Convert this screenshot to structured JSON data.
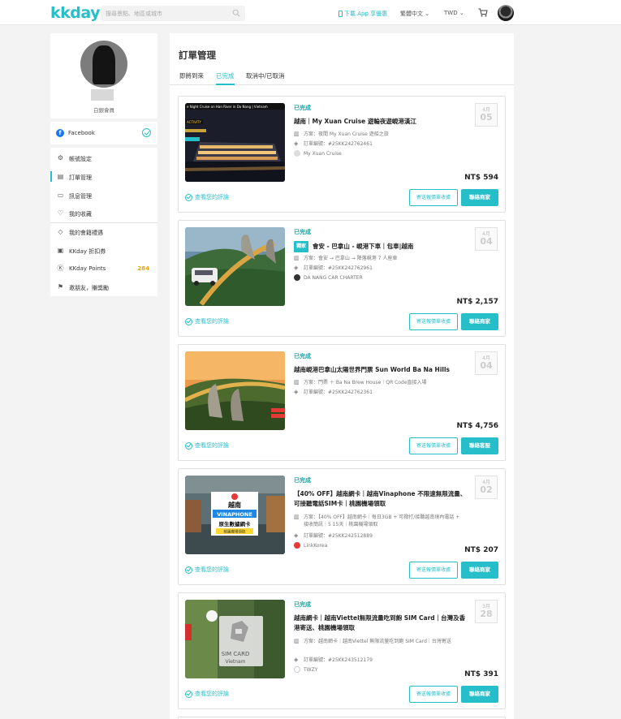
{
  "header": {
    "logo": "kkday",
    "search_placeholder": "搜尋景點、地區或城市",
    "app_link": "下載 App 享優惠",
    "language": "繁體中文 ⌄",
    "currency": "TWD ⌄"
  },
  "sidebar": {
    "member_label": "白銀會員",
    "facebook_label": "Facebook",
    "menu": [
      {
        "label": "帳號設定",
        "icon": "gear-icon"
      },
      {
        "label": "訂單管理",
        "icon": "order-icon"
      },
      {
        "label": "訊息管理",
        "icon": "message-icon"
      },
      {
        "label": "我的收藏",
        "icon": "heart-icon"
      },
      {
        "label": "我的會籍禮遇",
        "icon": "diamond-icon"
      },
      {
        "label": "KKday 折扣券",
        "icon": "coupon-icon"
      },
      {
        "label": "KKday Points",
        "icon": "points-icon",
        "count": "284"
      },
      {
        "label": "邀朋友，賺獎勵",
        "icon": "flag-icon"
      }
    ]
  },
  "main": {
    "title": "訂單管理",
    "tabs": [
      "即將到來",
      "已完成",
      "取消中/已取消"
    ],
    "active_tab": "已完成"
  },
  "orders": [
    {
      "status": "已完成",
      "title": "越南｜My Xuan Cruise 遊輪夜遊峴港漢江",
      "tag": "",
      "plan": "方案：夜間 My Xuan Cruise 遊船之旅",
      "order_no": "訂單編號：#25KK242762461",
      "supplier": "My Xuan Cruise",
      "month": "4月",
      "day": "05",
      "price": "NT$ 594",
      "review": "查看您的評論",
      "btn_outline": "寄送報價單收據",
      "btn_fill": "聯絡商家"
    },
    {
      "status": "已完成",
      "title": "會安 - 巴拿山 - 峴港下車｜包車|越南",
      "tag": "獨家",
      "plan": "方案：會安 → 巴拿山 → 降落峴港 7 人座車",
      "order_no": "訂單編號：#25KK242762961",
      "supplier": "DA NANG CAR CHARTER",
      "month": "4月",
      "day": "04",
      "price": "NT$ 2,157",
      "review": "查看您的評論",
      "btn_outline": "寄送報價單收據",
      "btn_fill": "聯絡商家"
    },
    {
      "status": "已完成",
      "title": "越南峴港巴拿山太陽世界門票 Sun World Ba Na Hills",
      "tag": "",
      "plan": "方案：門票 ＋ Ba Na Brew House｜QR Code直接入場",
      "order_no": "訂單編號：#25KK242762361",
      "supplier": "",
      "month": "4月",
      "day": "04",
      "price": "NT$ 4,756",
      "review": "查看您的評論",
      "btn_outline": "寄送報價單收據",
      "btn_fill": "聯絡客服"
    },
    {
      "status": "已完成",
      "title": "【40% OFF】越南網卡｜越南Vinaphone 不限速無限流量、可接聽電話SIM卡｜桃園機場領取",
      "tag": "",
      "plan": "方案：【40% OFF】越南網卡｜每日3GB + 可撥打/接聽越南境內電話 + 接收簡訊｜5 15天｜桃園機場領取",
      "order_no": "訂單編號：#25KK242512889",
      "supplier": "LinkKorea",
      "month": "4月",
      "day": "02",
      "price": "NT$ 207",
      "review": "查看您的評論",
      "btn_outline": "寄送報價單收據",
      "btn_fill": "聯絡商家"
    },
    {
      "status": "已完成",
      "title": "越南網卡｜越南Viettel無限流量吃到飽 SIM Card｜台灣及香港寄送、桃園機場領取",
      "tag": "",
      "plan": "方案：越南網卡｜越南Viettel 無限流量吃到飽 SIM Card｜台灣寄送",
      "order_no": "訂單編號：#25KK243512179",
      "supplier": "TWZY",
      "month": "3月",
      "day": "28",
      "price": "NT$ 391",
      "review": "查看您的評論",
      "btn_outline": "寄送報價單收據",
      "btn_fill": "聯絡商家"
    }
  ],
  "thumb_text": {
    "cruise_banner": "e Night Cruise on Han River in Da Nang | Vietnam",
    "cruise_tag": "ACTIVITY",
    "sim1_line1": "越南",
    "sim1_line2": "VINAPHONE",
    "sim1_line3": "原生數據網卡",
    "sim1_line4": "桃園機場領取",
    "sim2_line1": "SIM CARD",
    "sim2_line2": "Vietnam"
  },
  "colors": {
    "accent": "#26bec9",
    "status": "#14a5a5",
    "points": "#e8a317"
  }
}
